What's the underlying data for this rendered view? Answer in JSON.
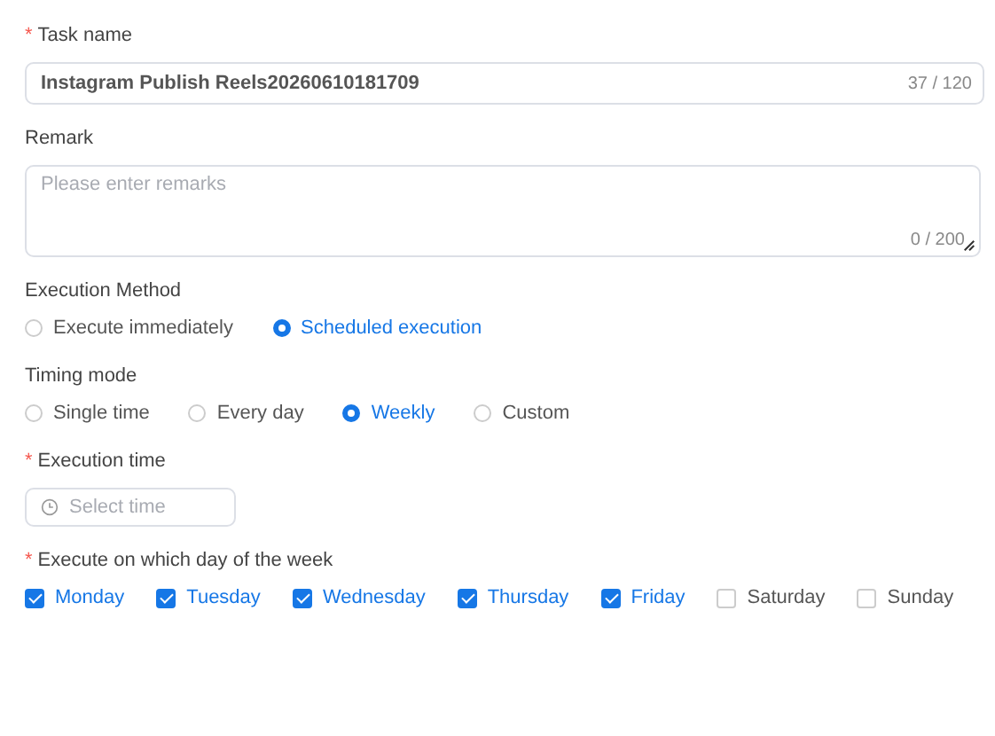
{
  "fields": [
    {
      "kind": "text",
      "label": "Task name",
      "required_mark": "*",
      "value": "Instagram Publish Reels20260610181709",
      "counter": "37 / 120"
    },
    {
      "kind": "textarea",
      "label": "Remark",
      "placeholder": "Please enter remarks",
      "counter": "0 / 200"
    },
    {
      "kind": "radio",
      "label": "Execution Method",
      "options": [
        {
          "label": "Execute immediately",
          "selected": false
        },
        {
          "label": "Scheduled execution",
          "selected": true
        }
      ]
    },
    {
      "kind": "radio",
      "label": "Timing mode",
      "options": [
        {
          "label": "Single time",
          "selected": false
        },
        {
          "label": "Every day",
          "selected": false
        },
        {
          "label": "Weekly",
          "selected": true
        },
        {
          "label": "Custom",
          "selected": false
        }
      ]
    },
    {
      "kind": "time",
      "label": "Execution time",
      "required_mark": "*",
      "placeholder": "Select time"
    },
    {
      "kind": "checkbox",
      "label": "Execute on which day of the week",
      "required_mark": "*",
      "options": [
        {
          "label": "Monday",
          "checked": true
        },
        {
          "label": "Tuesday",
          "checked": true
        },
        {
          "label": "Wednesday",
          "checked": true
        },
        {
          "label": "Thursday",
          "checked": true
        },
        {
          "label": "Friday",
          "checked": true
        },
        {
          "label": "Saturday",
          "checked": false
        },
        {
          "label": "Sunday",
          "checked": false
        }
      ]
    }
  ]
}
